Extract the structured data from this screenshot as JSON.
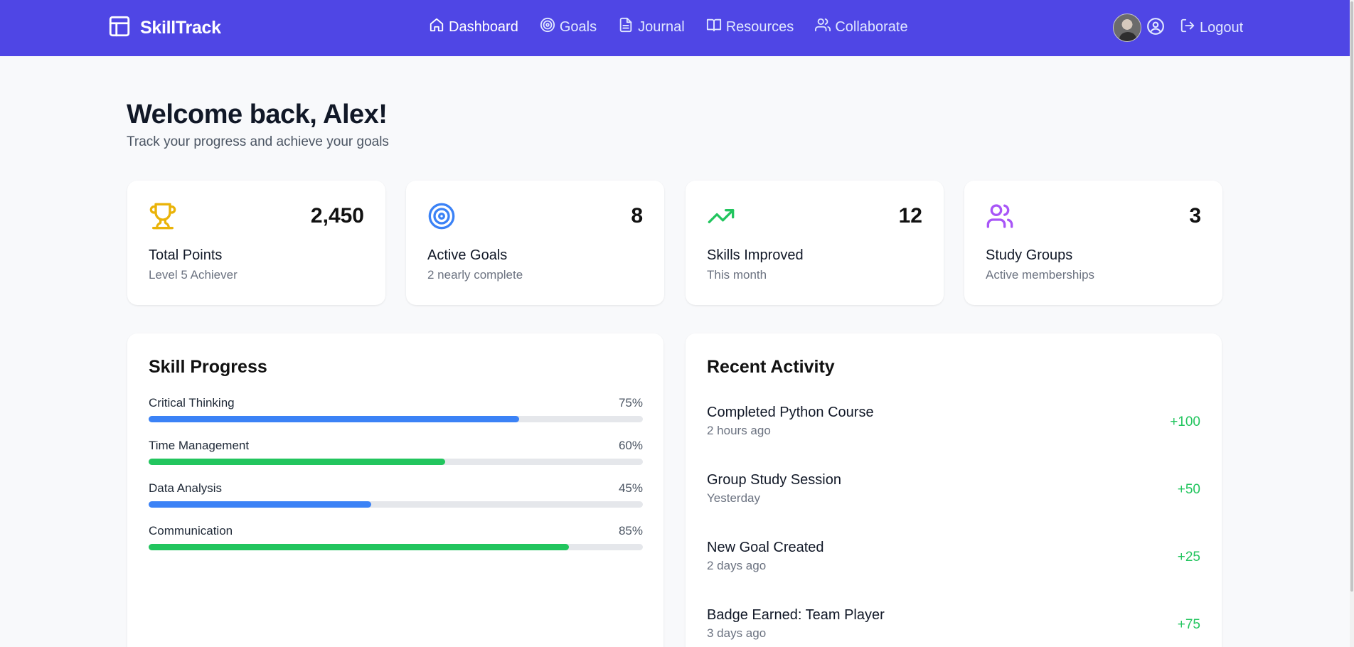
{
  "brand": {
    "name": "SkillTrack",
    "icon": "layout-icon"
  },
  "nav": {
    "items": [
      {
        "label": "Dashboard",
        "icon": "home-icon",
        "active": true
      },
      {
        "label": "Goals",
        "icon": "target-icon"
      },
      {
        "label": "Journal",
        "icon": "file-icon"
      },
      {
        "label": "Resources",
        "icon": "book-icon"
      },
      {
        "label": "Collaborate",
        "icon": "users-icon"
      }
    ],
    "profile_icon": "user-circle-icon",
    "logout_label": "Logout"
  },
  "welcome": {
    "title": "Welcome back, Alex!",
    "subtitle": "Track your progress and achieve your goals"
  },
  "stats": [
    {
      "value": "2,450",
      "label": "Total Points",
      "sub": "Level 5 Achiever",
      "icon": "trophy-icon",
      "color": "#eab308"
    },
    {
      "value": "8",
      "label": "Active Goals",
      "sub": "2 nearly complete",
      "icon": "target-icon",
      "color": "#3b82f6"
    },
    {
      "value": "12",
      "label": "Skills Improved",
      "sub": "This month",
      "icon": "trending-up-icon",
      "color": "#22c55e"
    },
    {
      "value": "3",
      "label": "Study Groups",
      "sub": "Active memberships",
      "icon": "users-icon",
      "color": "#a855f7"
    }
  ],
  "skill_progress": {
    "title": "Skill Progress",
    "items": [
      {
        "name": "Critical Thinking",
        "pct_label": "75%",
        "value": 75,
        "color": "#3b82f6"
      },
      {
        "name": "Time Management",
        "pct_label": "60%",
        "value": 60,
        "color": "#22c55e"
      },
      {
        "name": "Data Analysis",
        "pct_label": "45%",
        "value": 45,
        "color": "#3b82f6"
      },
      {
        "name": "Communication",
        "pct_label": "85%",
        "value": 85,
        "color": "#22c55e"
      }
    ]
  },
  "recent_activity": {
    "title": "Recent Activity",
    "items": [
      {
        "title": "Completed Python Course",
        "time": "2 hours ago",
        "points": "+100"
      },
      {
        "title": "Group Study Session",
        "time": "Yesterday",
        "points": "+50"
      },
      {
        "title": "New Goal Created",
        "time": "2 days ago",
        "points": "+25"
      },
      {
        "title": "Badge Earned: Team Player",
        "time": "3 days ago",
        "points": "+75"
      }
    ]
  },
  "colors": {
    "nav_bg": "#4f46e5",
    "positive": "#22c55e"
  }
}
